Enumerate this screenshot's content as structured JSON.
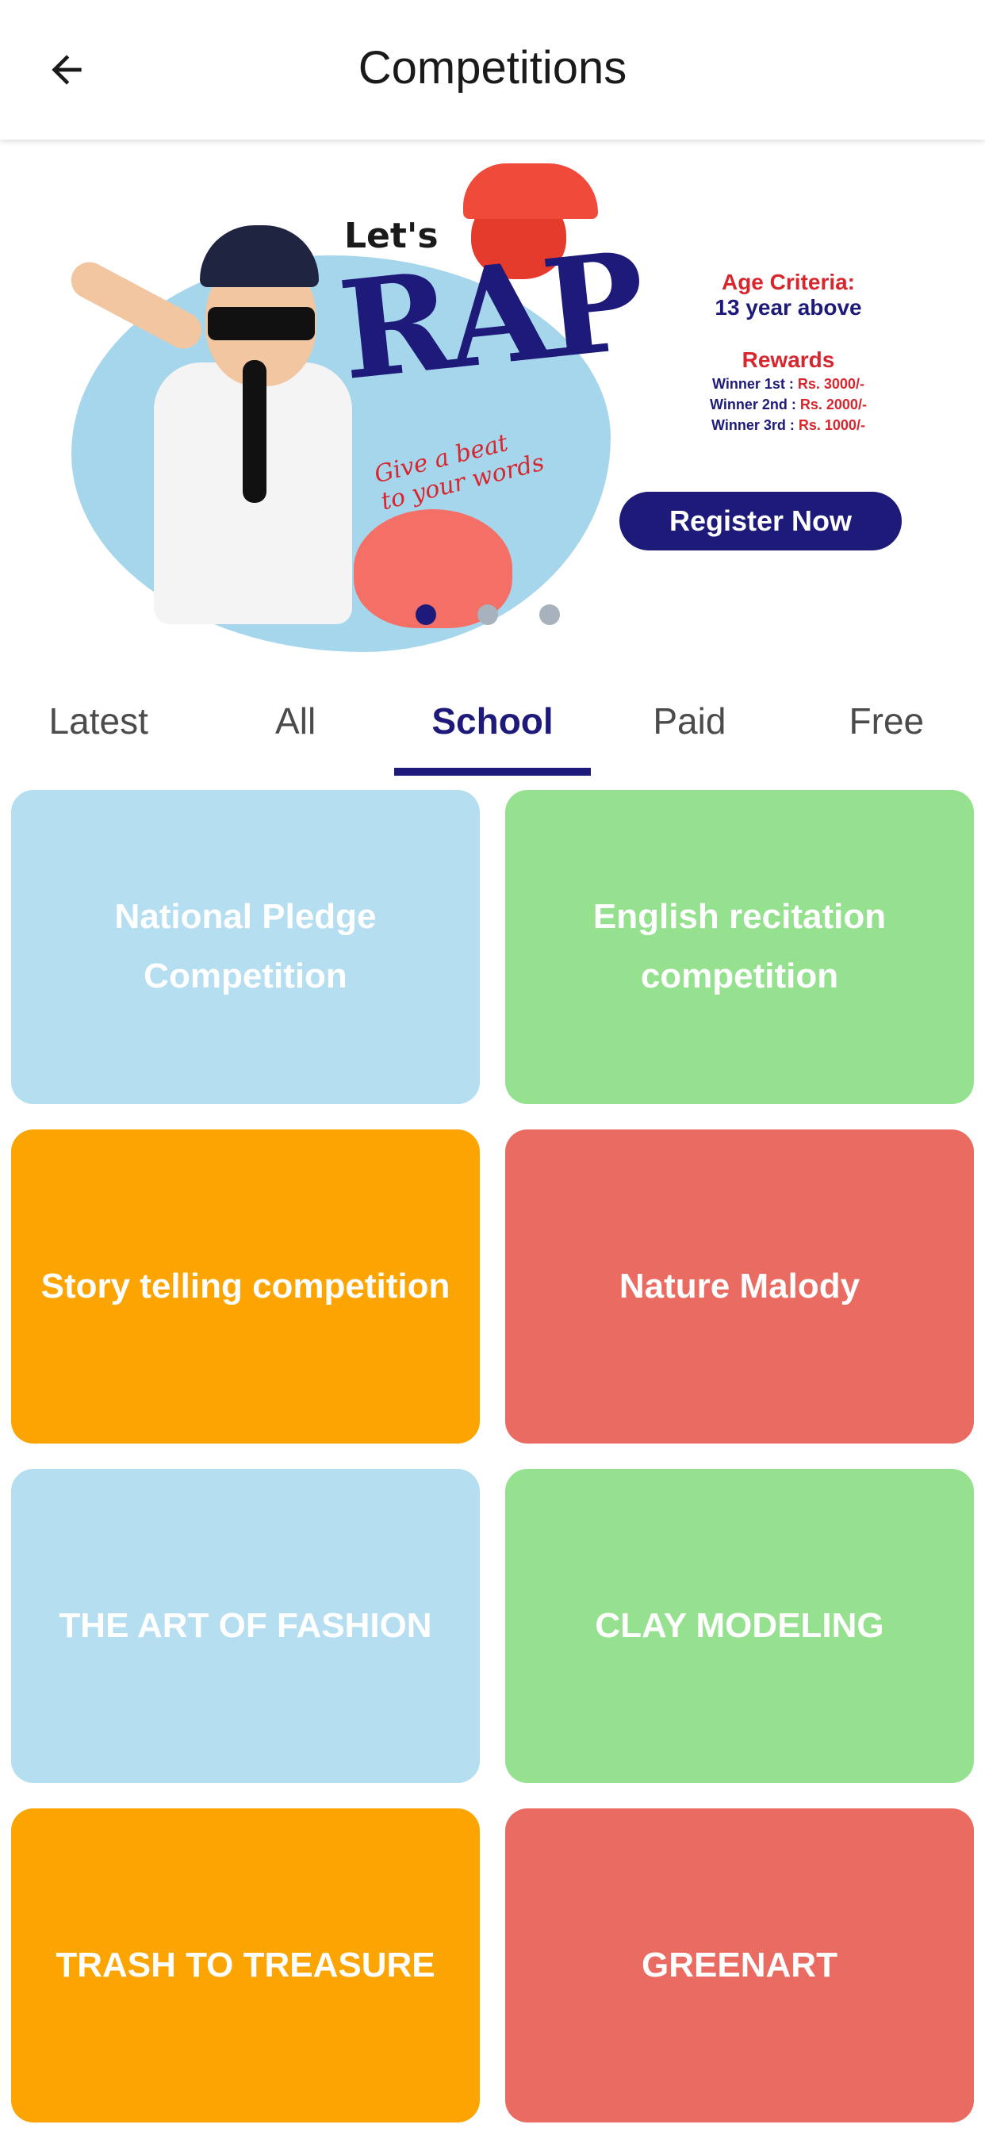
{
  "header": {
    "title": "Competitions",
    "back_icon": "arrow-left-icon"
  },
  "banner": {
    "lets": "Let's",
    "rap": "RAP",
    "tagline_1": "Give a beat",
    "tagline_2": "to your words",
    "age_title": "Age Criteria:",
    "age_value": "13 year above",
    "rewards_title": "Rewards",
    "rewards": [
      {
        "label": "Winner 1st : ",
        "amount": "Rs. 3000/-"
      },
      {
        "label": "Winner 2nd : ",
        "amount": "Rs. 2000/-"
      },
      {
        "label": "Winner 3rd : ",
        "amount": "Rs. 1000/-"
      }
    ],
    "register_label": "Register Now",
    "slide_count": 3,
    "active_slide": 1
  },
  "tabs": [
    {
      "label": "Latest",
      "active": false
    },
    {
      "label": "All",
      "active": false
    },
    {
      "label": "School",
      "active": true
    },
    {
      "label": "Paid",
      "active": false
    },
    {
      "label": "Free",
      "active": false
    }
  ],
  "colors": {
    "blue": "#b5dff1",
    "green": "#95e190",
    "orange": "#fba402",
    "red": "#ea6b62",
    "accent": "#1d1a7a"
  },
  "competitions": [
    {
      "title": "National Pledge Competition",
      "color": "#b5dff1"
    },
    {
      "title": "English recitation competition",
      "color": "#95e190"
    },
    {
      "title": "Story telling competition",
      "color": "#fba402"
    },
    {
      "title": "Nature Malody",
      "color": "#ea6b62"
    },
    {
      "title": "THE ART OF FASHION",
      "color": "#b5dff1"
    },
    {
      "title": "CLAY MODELING",
      "color": "#95e190"
    },
    {
      "title": "TRASH TO TREASURE",
      "color": "#fba402"
    },
    {
      "title": "GREENART",
      "color": "#ea6b62"
    }
  ]
}
